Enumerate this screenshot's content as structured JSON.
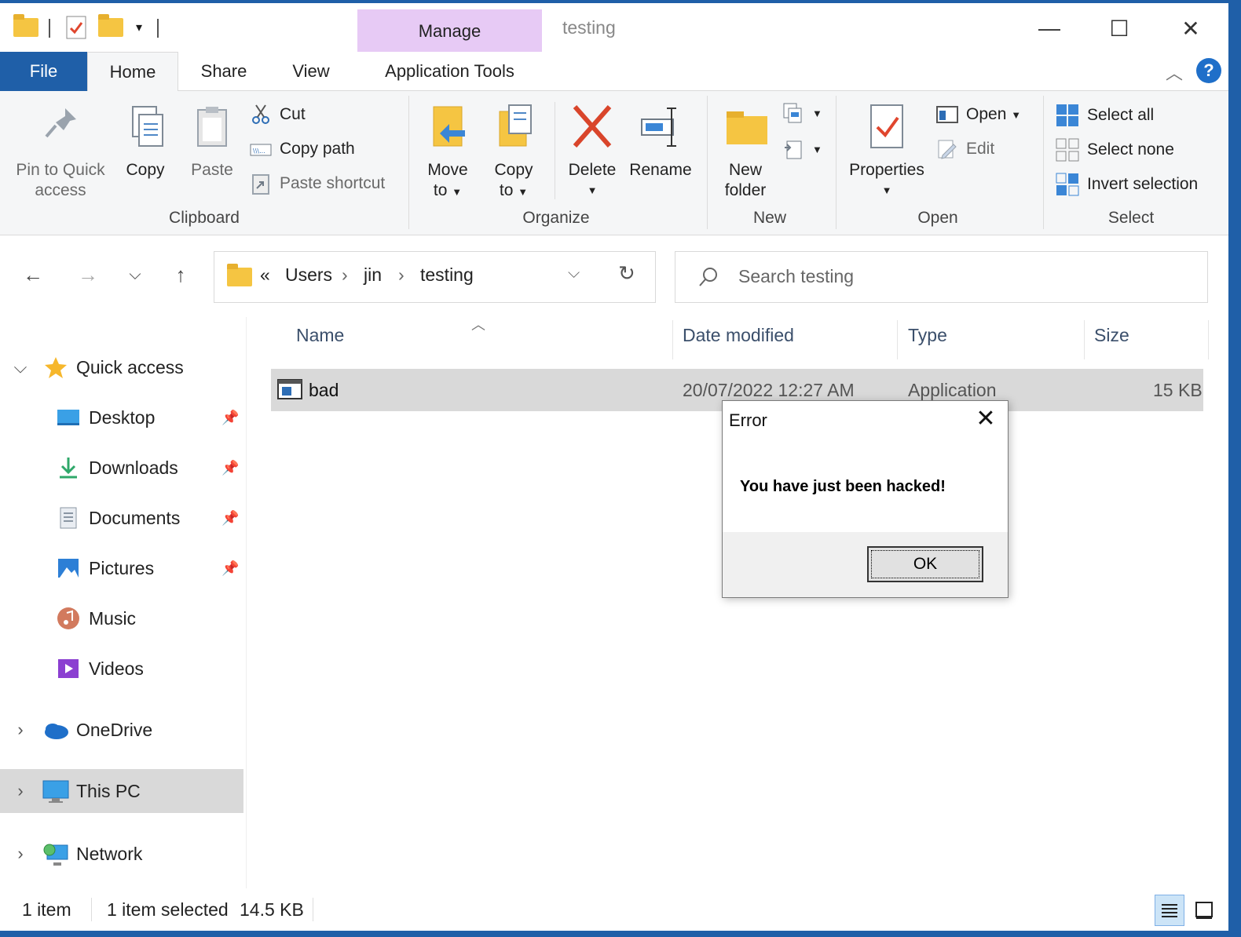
{
  "window": {
    "title": "testing",
    "context_tab": "Manage",
    "controls": {
      "minimize": "—",
      "maximize": "☐",
      "close": "✕"
    }
  },
  "ribbon_tabs": [
    "File",
    "Home",
    "Share",
    "View",
    "Application Tools"
  ],
  "ribbon": {
    "clipboard": {
      "label": "Clipboard",
      "pin": [
        "Pin to Quick",
        "access"
      ],
      "copy": "Copy",
      "paste": "Paste",
      "cut": "Cut",
      "copy_path": "Copy path",
      "paste_shortcut": "Paste shortcut"
    },
    "organize": {
      "label": "Organize",
      "move_to": [
        "Move",
        "to"
      ],
      "copy_to": [
        "Copy",
        "to"
      ],
      "delete": "Delete",
      "rename": "Rename"
    },
    "new": {
      "label": "New",
      "new_folder": [
        "New",
        "folder"
      ]
    },
    "open": {
      "label": "Open",
      "properties": "Properties",
      "open": "Open",
      "edit": "Edit"
    },
    "select": {
      "label": "Select",
      "select_all": "Select all",
      "select_none": "Select none",
      "invert": "Invert selection"
    }
  },
  "address": {
    "prefix": "«",
    "crumbs": [
      "Users",
      "jin",
      "testing"
    ],
    "separator": "›"
  },
  "search": {
    "placeholder": "Search testing"
  },
  "nav": {
    "quick_access": "Quick access",
    "items": [
      "Desktop",
      "Downloads",
      "Documents",
      "Pictures",
      "Music",
      "Videos"
    ],
    "onedrive": "OneDrive",
    "this_pc": "This PC",
    "network": "Network"
  },
  "columns": {
    "name": "Name",
    "date": "Date modified",
    "type": "Type",
    "size": "Size"
  },
  "files": [
    {
      "name": "bad",
      "date": "20/07/2022 12:27 AM",
      "type": "Application",
      "size": "15 KB"
    }
  ],
  "status": {
    "count": "1 item",
    "selected": "1 item selected",
    "size": "14.5 KB"
  },
  "dialog": {
    "title": "Error",
    "message": "You have just been hacked!",
    "ok": "OK"
  },
  "colors": {
    "accent": "#1f5fa8",
    "manage_tab": "#e7caf5",
    "selection": "#d9d9d9",
    "delete_red": "#d9452b"
  }
}
